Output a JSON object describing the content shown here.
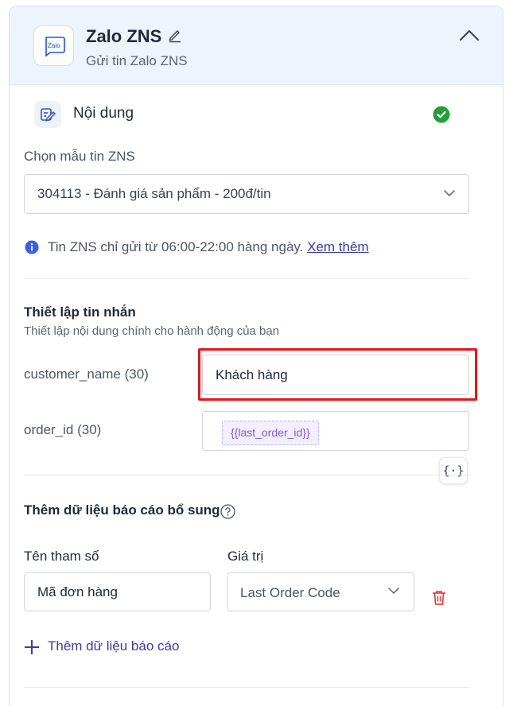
{
  "header": {
    "logo_text": "Zalo",
    "title": "Zalo ZNS",
    "subtitle": "Gửi tin Zalo ZNS"
  },
  "section": {
    "title": "Nội dung",
    "status": "complete"
  },
  "template": {
    "label": "Chọn mẫu tin ZNS",
    "selected": "304113 - Đánh giá sản phẩm - 200đ/tin"
  },
  "notice": {
    "text": "Tin ZNS chỉ gửi từ 06:00-22:00 hàng ngày.",
    "link": "Xem thêm"
  },
  "message_setup": {
    "title": "Thiết lập tin nhắn",
    "description": "Thiết lập nội dung chính cho hành động của bạn",
    "fields": [
      {
        "label": "customer_name (30)",
        "value": "Khách hàng"
      },
      {
        "label": "order_id (30)",
        "value": "{{last_order_id}}"
      }
    ],
    "variable_button": "{·}"
  },
  "report": {
    "title": "Thêm dữ liệu báo cáo bổ sung",
    "col_param": "Tên tham số",
    "col_value": "Giá trị",
    "rows": [
      {
        "param": "Mã đơn hàng",
        "value": "Last Order Code"
      }
    ],
    "add_label": "Thêm dữ liệu báo cáo"
  },
  "colors": {
    "accent": "#3b3ba8",
    "success": "#22a03a",
    "danger": "#e0302e",
    "highlight": "#e8141b"
  }
}
